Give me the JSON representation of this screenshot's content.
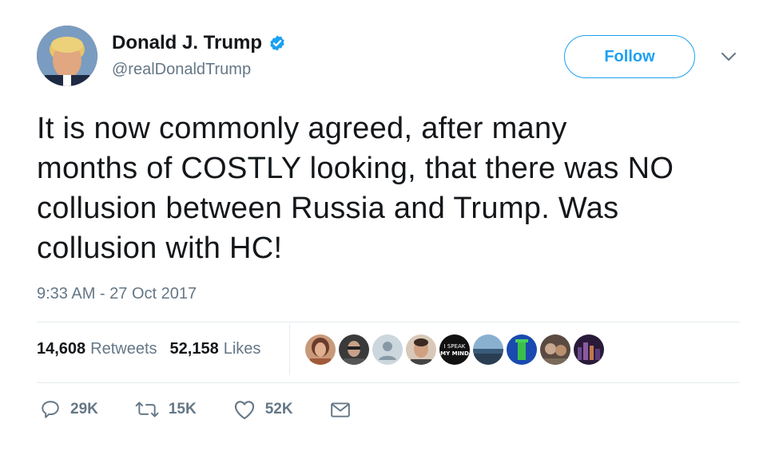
{
  "author": {
    "name": "Donald J. Trump",
    "handle": "@realDonaldTrump",
    "verified": true
  },
  "follow_button": {
    "label": "Follow"
  },
  "tweet": {
    "text": "It is now commonly agreed, after many\nmonths of COSTLY looking, that there was NO\ncollusion between Russia and Trump. Was\ncollusion with HC!",
    "timestamp": "9:33 AM - 27 Oct 2017"
  },
  "stats": {
    "retweets_count": "14,608",
    "retweets_label": "Retweets",
    "likes_count": "52,158",
    "likes_label": "Likes"
  },
  "liker_avatars": [
    {
      "color": "#8a5a44"
    },
    {
      "color": "#5a4a42"
    },
    {
      "color": "#ccd6dd"
    },
    {
      "color": "#9c6e5a"
    },
    {
      "color": "#111111",
      "text": "I SPEAK MY MIND"
    },
    {
      "color": "#4a6e8c"
    },
    {
      "color": "#2a8c3a"
    },
    {
      "color": "#6a5a52"
    },
    {
      "color": "#3a2a4a"
    }
  ],
  "actions": {
    "replies": "29K",
    "retweets": "15K",
    "likes": "52K"
  },
  "colors": {
    "accent": "#1da1f2",
    "text": "#14171a",
    "secondary": "#657786",
    "divider": "#e6ecf0"
  },
  "icons": [
    "verified-badge-icon",
    "chevron-down-icon",
    "reply-icon",
    "retweet-icon",
    "like-icon",
    "direct-message-icon"
  ]
}
